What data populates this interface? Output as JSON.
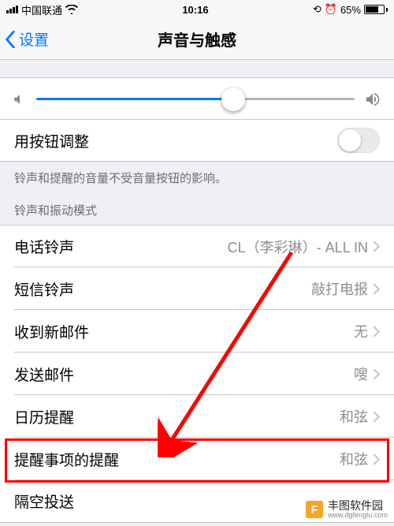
{
  "status": {
    "carrier": "中国联通",
    "time": "10:16",
    "battery_pct": "65%"
  },
  "nav": {
    "back_label": "设置",
    "title": "声音与触感"
  },
  "volume": {
    "button_adjust_label": "用按钮调整",
    "footer": "铃声和提醒的音量不受音量按钮的影响。"
  },
  "section_header": "铃声和振动模式",
  "rows": {
    "ringtone": {
      "label": "电话铃声",
      "value": "CL（李彩琳）- ALL IN"
    },
    "text_tone": {
      "label": "短信铃声",
      "value": "敲打电报"
    },
    "new_mail": {
      "label": "收到新邮件",
      "value": "无"
    },
    "sent_mail": {
      "label": "发送邮件",
      "value": "嗖"
    },
    "calendar": {
      "label": "日历提醒",
      "value": "和弦"
    },
    "reminder": {
      "label": "提醒事项的提醒",
      "value": "和弦"
    },
    "airdrop": {
      "label": "隔空投送",
      "value": ""
    }
  },
  "watermark": {
    "brand": "丰图软件园",
    "url": "www.dgfengtu.com"
  },
  "colors": {
    "accent": "#007aff",
    "highlight": "#ff0000"
  }
}
